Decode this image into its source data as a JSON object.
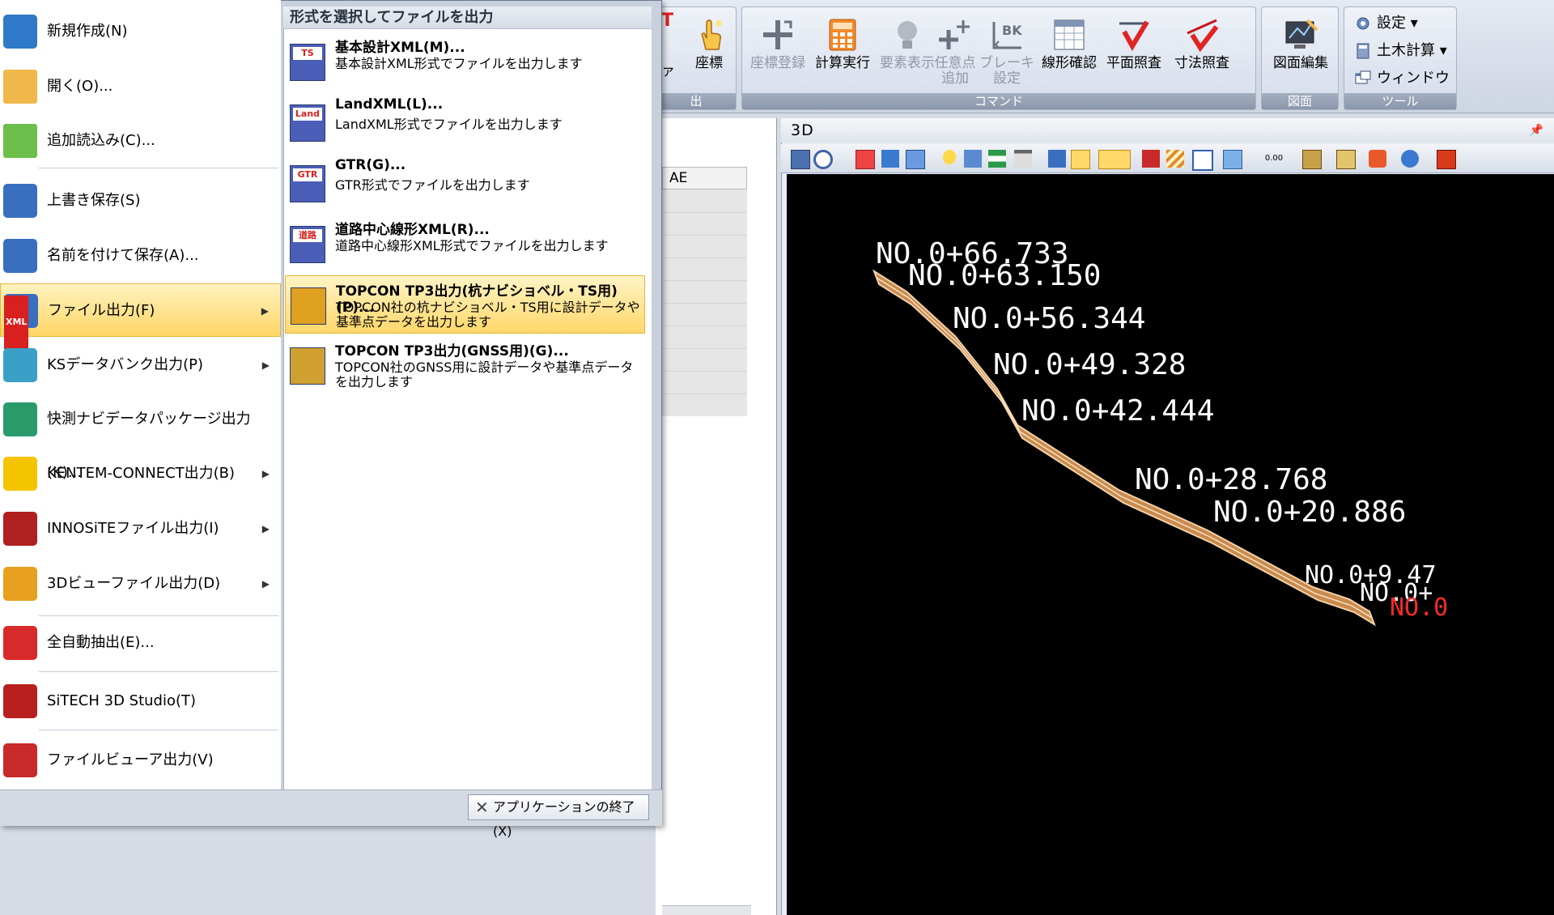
{
  "ribbon": {
    "partial_left": {
      "label_t": "T",
      "label_f": "ァ",
      "group_label": "出"
    },
    "coord_btn": "座標",
    "command_group": {
      "label": "コマンド",
      "buttons": [
        "座標登録",
        "計算実行",
        "要素表示",
        "任意点\n追加",
        "ブレーキ\n設定",
        "線形確認",
        "平面照査",
        "寸法照査"
      ],
      "disabled": [
        true,
        false,
        true,
        true,
        true,
        false,
        false,
        false
      ]
    },
    "drawing_group": {
      "label": "図面",
      "button": "図面編集"
    },
    "tool_group": {
      "label": "ツール",
      "items": [
        "設定",
        "土木計算",
        "ウィンドウ"
      ]
    }
  },
  "grid": {
    "column_header": "AE"
  },
  "panel3d": {
    "title": "3D",
    "pin_icon": "pin-icon"
  },
  "viewport": {
    "stations": [
      "NO.0+66.733",
      "NO.0+63.150",
      "NO.0+56.344",
      "NO.0+49.328",
      "NO.0+42.444",
      "NO.0+28.768",
      "NO.0+20.886",
      "NO.0+9.47",
      "NO.0+",
      "NO.0"
    ],
    "road_color": "#c98a4e",
    "label_color": "#ffffff"
  },
  "menu": {
    "items": [
      {
        "label": "新規作成(N)",
        "icon": "new-file-icon",
        "arrow": false
      },
      {
        "label": "開く(O)...",
        "icon": "open-folder-icon",
        "arrow": false
      },
      {
        "label": "追加読込み(C)...",
        "icon": "add-folder-icon",
        "arrow": false
      },
      {
        "label": "上書き保存(S)",
        "icon": "save-icon",
        "arrow": false
      },
      {
        "label": "名前を付けて保存(A)...",
        "icon": "save-as-icon",
        "arrow": false
      },
      {
        "label": "ファイル出力(F)",
        "icon": "xml-export-icon",
        "arrow": true
      },
      {
        "label": "KSデータバンク出力(P)",
        "icon": "ks-databank-icon",
        "arrow": true
      },
      {
        "label": "快測ナビデータパッケージ出力(K)...",
        "icon": "navi-package-icon",
        "arrow": false
      },
      {
        "label": "KENTEM-CONNECT出力(B)",
        "icon": "kentem-connect-icon",
        "arrow": true
      },
      {
        "label": "INNOSiTEファイル出力(I)",
        "icon": "innosite-icon",
        "arrow": true
      },
      {
        "label": "3Dビューファイル出力(D)",
        "icon": "3d-view-icon",
        "arrow": true
      },
      {
        "label": "全自動抽出(E)...",
        "icon": "auto-extract-icon",
        "arrow": false
      },
      {
        "label": "SiTECH 3D Studio(T)",
        "icon": "sitech-studio-icon",
        "arrow": false
      },
      {
        "label": "ファイルビューア出力(V)",
        "icon": "file-viewer-icon",
        "arrow": false
      }
    ],
    "submenu": {
      "header": "形式を選択してファイルを出力",
      "items": [
        {
          "title": "基本設計XML(M)...",
          "desc": "基本設計XML形式でファイルを出力します",
          "icon_text": "TS"
        },
        {
          "title": "LandXML(L)...",
          "desc": "LandXML形式でファイルを出力します",
          "icon_text": "Land"
        },
        {
          "title": "GTR(G)...",
          "desc": "GTR形式でファイルを出力します",
          "icon_text": "GTR"
        },
        {
          "title": "道路中心線形XML(R)...",
          "desc": "道路中心線形XML形式でファイルを出力します",
          "icon_text": "道路"
        },
        {
          "title": "TOPCON TP3出力(杭ナビショベル・TS用)(P)...",
          "desc": "TOPCON社の杭ナビショベル・TS用に設計データや基準点データを出力します",
          "icon_text": ""
        },
        {
          "title": "TOPCON TP3出力(GNSS用)(G)...",
          "desc": "TOPCON社のGNSS用に設計データや基準点データを出力します",
          "icon_text": ""
        }
      ]
    },
    "exit_button": "アプリケーションの終了(X)"
  }
}
